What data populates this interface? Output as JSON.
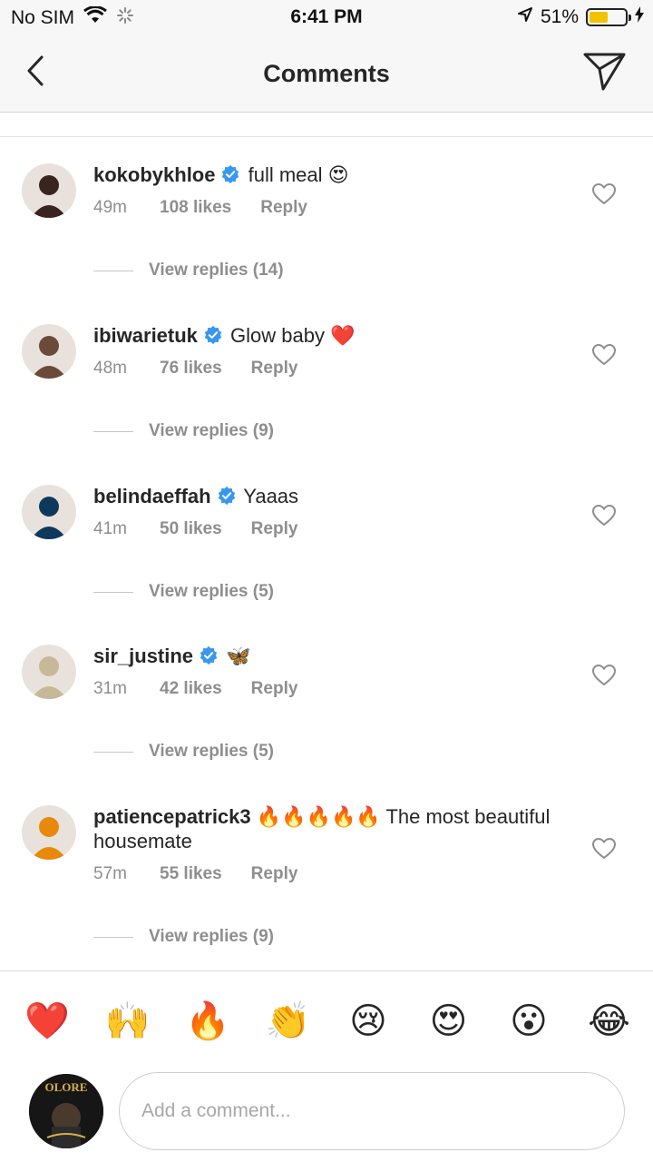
{
  "status_bar": {
    "carrier": "No SIM",
    "time": "6:41 PM",
    "battery_percent": "51%",
    "battery_level": 0.51
  },
  "header": {
    "title": "Comments",
    "back_icon": "chevron-left-icon",
    "send_icon": "paper-plane-icon"
  },
  "comments": [
    {
      "username": "kokobykhloe",
      "verified": true,
      "text": "full meal 😍",
      "time": "49m",
      "likes": "108 likes",
      "reply": "Reply",
      "view_replies": "View replies (14)",
      "avatar_color": "#3a2420"
    },
    {
      "username": "ibiwarietuk",
      "verified": true,
      "text": "Glow baby ❤️",
      "time": "48m",
      "likes": "76 likes",
      "reply": "Reply",
      "view_replies": "View replies (9)",
      "avatar_color": "#6b4a3a"
    },
    {
      "username": "belindaeffah",
      "verified": true,
      "text": "Yaaas",
      "time": "41m",
      "likes": "50 likes",
      "reply": "Reply",
      "view_replies": "View replies (5)",
      "avatar_color": "#0d3a5c"
    },
    {
      "username": "sir_justine",
      "verified": true,
      "text": "🦋",
      "time": "31m",
      "likes": "42 likes",
      "reply": "Reply",
      "view_replies": "View replies (5)",
      "avatar_color": "#c8b89a"
    },
    {
      "username": "patiencepatrick3",
      "verified": false,
      "text": "🔥🔥🔥🔥🔥 The most beautiful housemate",
      "time": "57m",
      "likes": "55 likes",
      "reply": "Reply",
      "view_replies": "View replies (9)",
      "avatar_color": "#e8890c"
    }
  ],
  "emoji_bar": [
    "❤️",
    "🙌",
    "🔥",
    "👏",
    "😢",
    "😍",
    "😮",
    "😂"
  ],
  "composer": {
    "placeholder": "Add a comment...",
    "avatar_text": "OLORE"
  },
  "colors": {
    "verified": "#3897f0",
    "muted": "#8e8e8e",
    "text": "#262626",
    "battery": "#f2c200"
  }
}
